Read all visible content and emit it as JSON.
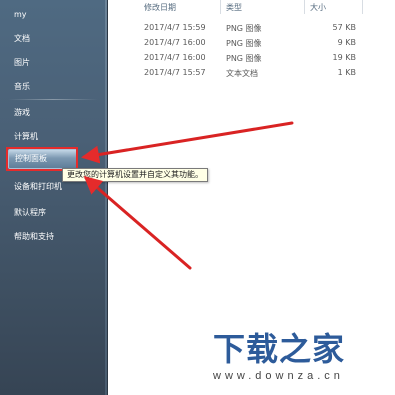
{
  "start_menu": {
    "items": [
      {
        "label": "my"
      },
      {
        "label": "文档"
      },
      {
        "label": "图片"
      },
      {
        "label": "音乐"
      },
      {
        "label": "游戏"
      },
      {
        "label": "计算机"
      },
      {
        "label": "控制面板",
        "selected": true
      },
      {
        "label": "设备和打印机"
      },
      {
        "label": "默认程序"
      },
      {
        "label": "帮助和支持"
      }
    ]
  },
  "tooltip": {
    "text": "更改您的计算机设置并自定义其功能。"
  },
  "file_list": {
    "headers": {
      "date": "修改日期",
      "type": "类型",
      "size": "大小"
    },
    "rows": [
      {
        "date": "2017/4/7 15:59",
        "type": "PNG 图像",
        "size": "57 KB"
      },
      {
        "date": "2017/4/7 16:00",
        "type": "PNG 图像",
        "size": "9 KB"
      },
      {
        "date": "2017/4/7 16:00",
        "type": "PNG 图像",
        "size": "19 KB"
      },
      {
        "date": "2017/4/7 15:57",
        "type": "文本文档",
        "size": "1 KB"
      }
    ]
  },
  "watermark": {
    "title": "下载之家",
    "url": "www.downza.cn"
  },
  "colors": {
    "annotation": "#e52b2b",
    "panel": "#4a6076",
    "watermark_title": "#2d5b9a"
  }
}
